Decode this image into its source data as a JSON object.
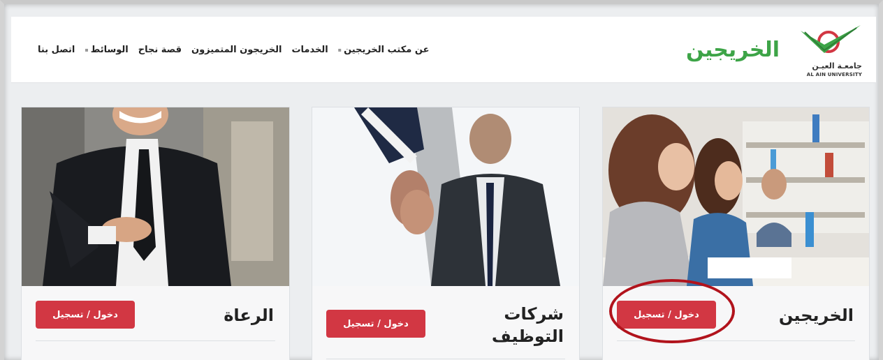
{
  "header": {
    "brand": "الخريجين",
    "logo_ar": "جامعـة العيـن",
    "logo_en": "AL AIN UNIVERSITY"
  },
  "nav": {
    "items": [
      {
        "label": "عن مكتب الخريجين",
        "caret": true
      },
      {
        "label": "الخدمات",
        "caret": false
      },
      {
        "label": "الخريجون المتميزون",
        "caret": false
      },
      {
        "label": "قصة نجاح",
        "caret": false
      },
      {
        "label": "الوسائط",
        "caret": true
      },
      {
        "label": "اتصل بنا",
        "caret": false
      }
    ]
  },
  "cards": [
    {
      "title": "الخريجين",
      "button": "دخول / تسجيل"
    },
    {
      "title_line1": "شركات",
      "title_line2": "التوظيف",
      "button": "دخول / تسجيل"
    },
    {
      "title": "الرعاة",
      "button": "دخول / تسجيل"
    }
  ],
  "colors": {
    "brand_green": "#3da447",
    "button_red": "#d23743",
    "highlight_ring": "#b1131c"
  }
}
